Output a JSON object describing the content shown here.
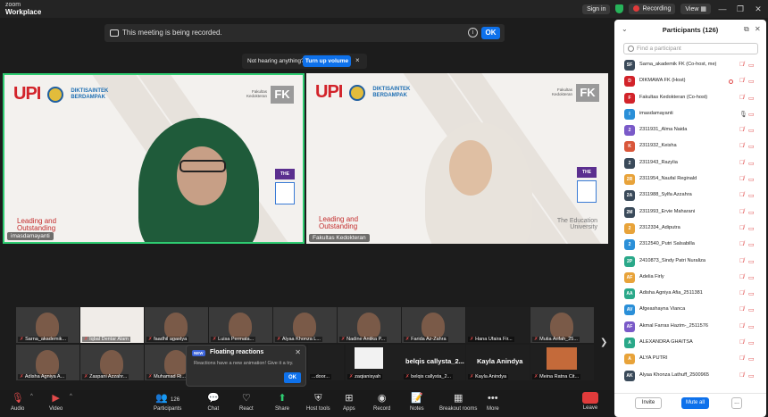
{
  "titlebar": {
    "brand_top": "zoom",
    "brand_bottom": "Workplace",
    "sign_in": "Sign in",
    "recording": "Recording",
    "view": "View"
  },
  "banner": {
    "recording_text": "This meeting is being recorded.",
    "ok_label": "OK"
  },
  "hearing": {
    "text": "Not hearing anything?",
    "button": "Turn up volume",
    "close": "×"
  },
  "slide": {
    "upi": "UPI",
    "diktisaintek_1": "DIKTISAINTEK",
    "diktisaintek_2": "BERDAMPAK",
    "fakultas_1": "Fakultas",
    "fakultas_2": "Kedokteran",
    "fk": "FK",
    "leading_1": "Leading and",
    "leading_2": "Outstanding",
    "the": "THE",
    "edu_1": "The Education",
    "edu_2": "University"
  },
  "main_tiles": [
    {
      "name": "imasdamayanti"
    },
    {
      "name": "Fakultas Kedokteran"
    }
  ],
  "thumbnails": [
    {
      "label": "Sarna_akademik..."
    },
    {
      "label": "Iqbal Dentar Alam"
    },
    {
      "label": "faadhil agastya"
    },
    {
      "label": "Luisa Permata..."
    },
    {
      "label": "Alyaa Khonza L..."
    },
    {
      "label": "Nadine Antika P..."
    },
    {
      "label": "Farida Az-Zahra"
    },
    {
      "label": "Hana Ufaira Fir..."
    },
    {
      "label": "Mutia Arifah_25..."
    },
    {
      "label": "Adisha Agniya A..."
    },
    {
      "label": "Zaspani Azzahr..."
    },
    {
      "label": "Muhamad Ri..."
    },
    {
      "label": "...door..."
    },
    {
      "label": "zaqianisyah"
    },
    {
      "label": "belqis callysta_2..."
    },
    {
      "label": "Kayla Anindya"
    },
    {
      "label": "Meina Ratna Cit..."
    }
  ],
  "big_names": [
    "belqis callysta_2...",
    "Kayla Anindya"
  ],
  "popup": {
    "badge": "NEW",
    "title": "Floating reactions",
    "desc": "Reactions have a new animation! Give it a try.",
    "ok": "OK"
  },
  "toolbar": {
    "audio": "Audio",
    "video": "Video",
    "participants": "Participants",
    "participant_count": "126",
    "chat": "Chat",
    "react": "React",
    "share": "Share",
    "host_tools": "Host tools",
    "apps": "Apps",
    "record": "Record",
    "notes": "Notes",
    "breakout": "Breakout rooms",
    "more": "More",
    "leave": "Leave"
  },
  "panel": {
    "title": "Participants (126)",
    "search_placeholder": "Find a participant",
    "invite": "Invite",
    "mute_all": "Mute all",
    "more": "..."
  },
  "participants": [
    {
      "initials": "SF",
      "color": "#3a4a5a",
      "name": "Sarna_akademik FK (Co-host, me)",
      "mic": "muted"
    },
    {
      "initials": "D",
      "color": "#d2232a",
      "name": "DIKMAWA FK (Host)",
      "mic": "muted"
    },
    {
      "initials": "F",
      "color": "#d2232a",
      "name": "Fakultas Kedokteran (Co-host)",
      "mic": "muted"
    },
    {
      "initials": "I",
      "color": "#2a8fd8",
      "name": "imasdamayanti",
      "mic": "on"
    },
    {
      "initials": "2",
      "color": "#7a5ac8",
      "name": "2311931_Alma Naida",
      "mic": "muted"
    },
    {
      "initials": "K",
      "color": "#d9573b",
      "name": "2311932_Keisha",
      "mic": "muted"
    },
    {
      "initials": "2",
      "color": "#3a4a5a",
      "name": "2311943_Razylia",
      "mic": "muted"
    },
    {
      "initials": "2R",
      "color": "#e8a33a",
      "name": "2311954_Naufal Reginald",
      "mic": "muted"
    },
    {
      "initials": "2A",
      "color": "#3a4a5a",
      "name": "2311988_Sylfa Azzahra",
      "mic": "muted"
    },
    {
      "initials": "2M",
      "color": "#3a4a5a",
      "name": "2311993_Ervie Maharani",
      "mic": "muted"
    },
    {
      "initials": "2",
      "color": "#e8a33a",
      "name": "2312334_Adiputra",
      "mic": "muted"
    },
    {
      "initials": "2",
      "color": "#2a8fd8",
      "name": "2312540_Putri Salsabilla",
      "mic": "muted"
    },
    {
      "initials": "2P",
      "color": "#2aa889",
      "name": "2410873_Sindy Patri Nuraliza",
      "mic": "muted"
    },
    {
      "initials": "AF",
      "color": "#e8a33a",
      "name": "Adelia Firly",
      "mic": "muted"
    },
    {
      "initials": "AA",
      "color": "#2aa889",
      "name": "Adisha Agniya Afia_2511381",
      "mic": "muted"
    },
    {
      "initials": "AV",
      "color": "#2a8fd8",
      "name": "Afgeashayna Vianca",
      "mic": "muted"
    },
    {
      "initials": "AF",
      "color": "#7a5ac8",
      "name": "Akmal Farras Hazim-_2511576",
      "mic": "muted"
    },
    {
      "initials": "A",
      "color": "#2aa889",
      "name": "ALEXANDRA GHAITSA",
      "mic": "muted"
    },
    {
      "initials": "A",
      "color": "#e8a33a",
      "name": "ALYA PUTRI",
      "mic": "muted"
    },
    {
      "initials": "AK",
      "color": "#3a4a5a",
      "name": "Alyaa Khonza Lathuff_2500965",
      "mic": "muted"
    }
  ]
}
